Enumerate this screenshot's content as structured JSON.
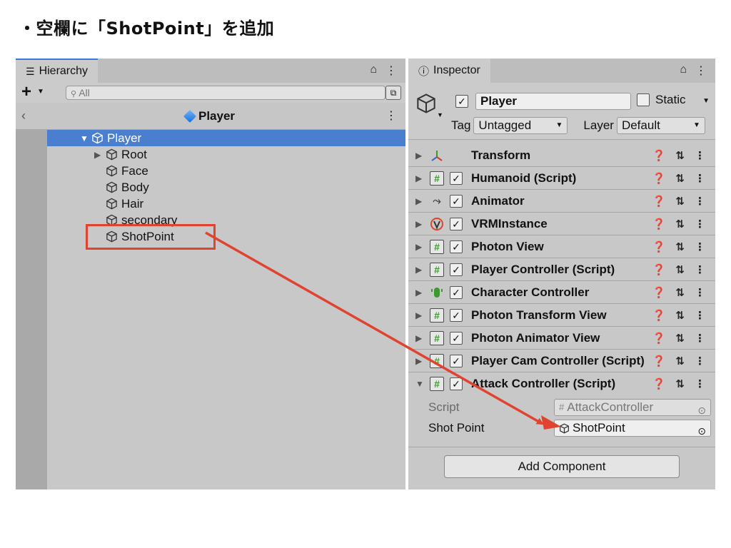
{
  "slide": {
    "title": "・空欄に「ShotPoint」を追加"
  },
  "hierarchy": {
    "tab_label": "Hierarchy",
    "search_placeholder": "All",
    "prefab_name": "Player",
    "items": [
      {
        "label": "Player",
        "level": 0,
        "expanded": true,
        "selected": true
      },
      {
        "label": "Root",
        "level": 1,
        "expanded": false
      },
      {
        "label": "Face",
        "level": 1
      },
      {
        "label": "Body",
        "level": 1
      },
      {
        "label": "Hair",
        "level": 1
      },
      {
        "label": "secondary",
        "level": 1
      },
      {
        "label": "ShotPoint",
        "level": 1
      }
    ]
  },
  "inspector": {
    "tab_label": "Inspector",
    "object_name": "Player",
    "static_label": "Static",
    "tag_label": "Tag",
    "tag_value": "Untagged",
    "layer_label": "Layer",
    "layer_value": "Default",
    "components": [
      {
        "label": "Transform",
        "icon": "transform-icon",
        "checkbox": false
      },
      {
        "label": "Humanoid (Script)",
        "icon": "script-icon",
        "checkbox": true
      },
      {
        "label": "Animator",
        "icon": "animator-icon",
        "checkbox": true
      },
      {
        "label": "VRMInstance",
        "icon": "vrm-icon",
        "checkbox": true
      },
      {
        "label": "Photon View",
        "icon": "script-icon",
        "checkbox": true
      },
      {
        "label": "Player Controller (Script)",
        "icon": "script-icon",
        "checkbox": true
      },
      {
        "label": "Character Controller",
        "icon": "character-controller-icon",
        "checkbox": true
      },
      {
        "label": "Photon Transform View",
        "icon": "script-icon",
        "checkbox": true
      },
      {
        "label": "Photon Animator View",
        "icon": "script-icon",
        "checkbox": true
      },
      {
        "label": "Player Cam Controller (Script)",
        "icon": "script-icon",
        "checkbox": true
      },
      {
        "label": "Attack Controller (Script)",
        "icon": "script-icon",
        "checkbox": true,
        "expanded": true
      }
    ],
    "properties": [
      {
        "label": "Script",
        "value": "AttackController",
        "disabled": true
      },
      {
        "label": "Shot Point",
        "value": "ShotPoint",
        "disabled": false
      }
    ],
    "add_component_label": "Add Component"
  },
  "colors": {
    "highlight": "#e0432f",
    "selection": "#4a7fd0",
    "panel_bg": "#c8c8c8",
    "script_hash": "#3a9a2a"
  }
}
